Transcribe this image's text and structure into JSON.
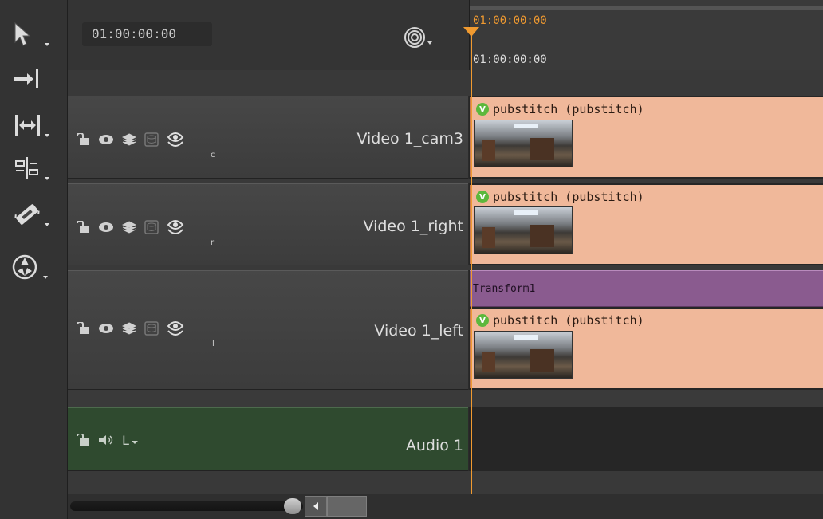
{
  "header": {
    "timecode": "01:00:00:00",
    "ruler_timecode_top": "01:00:00:00",
    "ruler_timecode_bottom": "01:00:00:00",
    "snap_icon": "snap-target-icon"
  },
  "toolbar": {
    "tools": [
      {
        "name": "pointer-tool",
        "icon": "arrow-pointer-icon"
      },
      {
        "name": "track-select-tool",
        "icon": "arrow-to-bar-icon"
      },
      {
        "name": "slip-tool",
        "icon": "slip-brackets-icon"
      },
      {
        "name": "roll-tool",
        "icon": "roll-edit-icon"
      },
      {
        "name": "razor-tool",
        "icon": "razor-blade-icon"
      },
      {
        "name": "multi-view-tool",
        "icon": "aperture-circle-icon"
      }
    ]
  },
  "tracks": [
    {
      "name": "Video 1_cam3",
      "letter": "c"
    },
    {
      "name": "Video 1_right",
      "letter": "r"
    },
    {
      "name": "Video 1_left",
      "letter": "l"
    }
  ],
  "audio_track": {
    "name": "Audio 1",
    "channel": "L"
  },
  "clips": {
    "clip_label": "pubstitch (pubstitch)",
    "badge": "V",
    "effect_label": "Transform1"
  },
  "colors": {
    "playhead": "#f09a30",
    "clip": "#f0b89a",
    "effect": "#8a5b8f",
    "audio_header": "#2f4a2f",
    "badge": "#5cb83c"
  }
}
